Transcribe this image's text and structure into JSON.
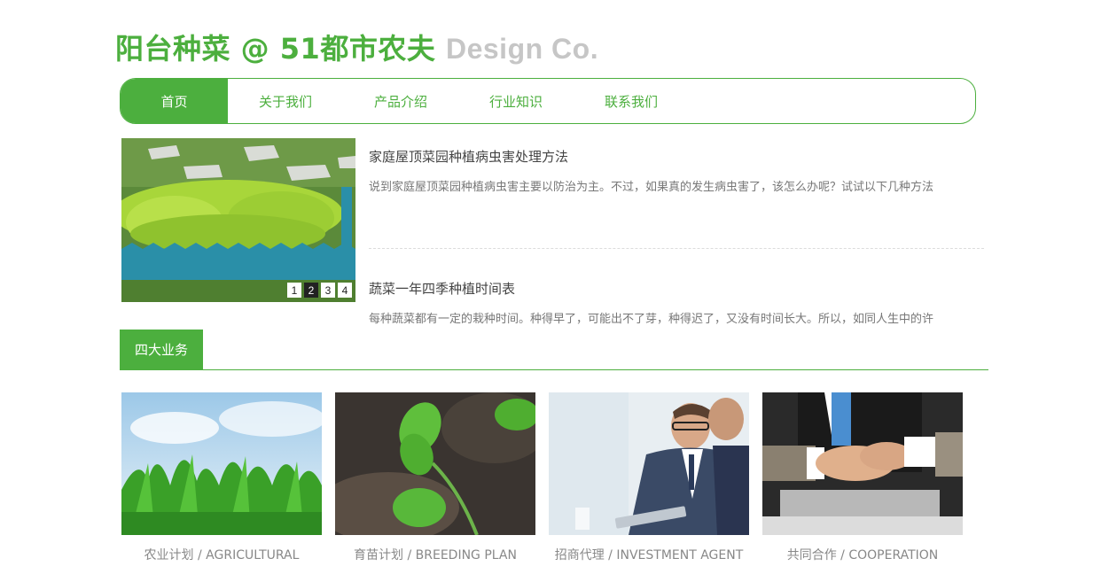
{
  "logo": {
    "brand": "阳台种菜 @ 51都市农夫",
    "tagline": "Design Co."
  },
  "nav": {
    "items": [
      {
        "label": "首页",
        "active": true
      },
      {
        "label": "关于我们"
      },
      {
        "label": "产品介绍"
      },
      {
        "label": "行业知识"
      },
      {
        "label": "联系我们"
      }
    ]
  },
  "slider": {
    "dots": [
      "1",
      "2",
      "3",
      "4"
    ],
    "active_dot": "2"
  },
  "news": [
    {
      "title": "家庭屋顶菜园种植病虫害处理方法",
      "desc": "说到家庭屋顶菜园种植病虫害主要以防治为主。不过，如果真的发生病虫害了，该怎么办呢？试试以下几种方法"
    },
    {
      "title": "蔬菜一年四季种植时间表",
      "desc": "每种蔬菜都有一定的栽种时间。种得早了，可能出不了芽，种得迟了，又没有时间长大。所以，如同人生中的许"
    }
  ],
  "section": {
    "title": "四大业务"
  },
  "cards": [
    {
      "caption": "农业计划 / AGRICULTURAL"
    },
    {
      "caption": "育苗计划 / BREEDING PLAN"
    },
    {
      "caption": "招商代理 / INVESTMENT AGENT"
    },
    {
      "caption": "共同合作 / COOPERATION"
    }
  ],
  "colors": {
    "accent": "#4caf3e",
    "muted": "#c6c6c6"
  }
}
